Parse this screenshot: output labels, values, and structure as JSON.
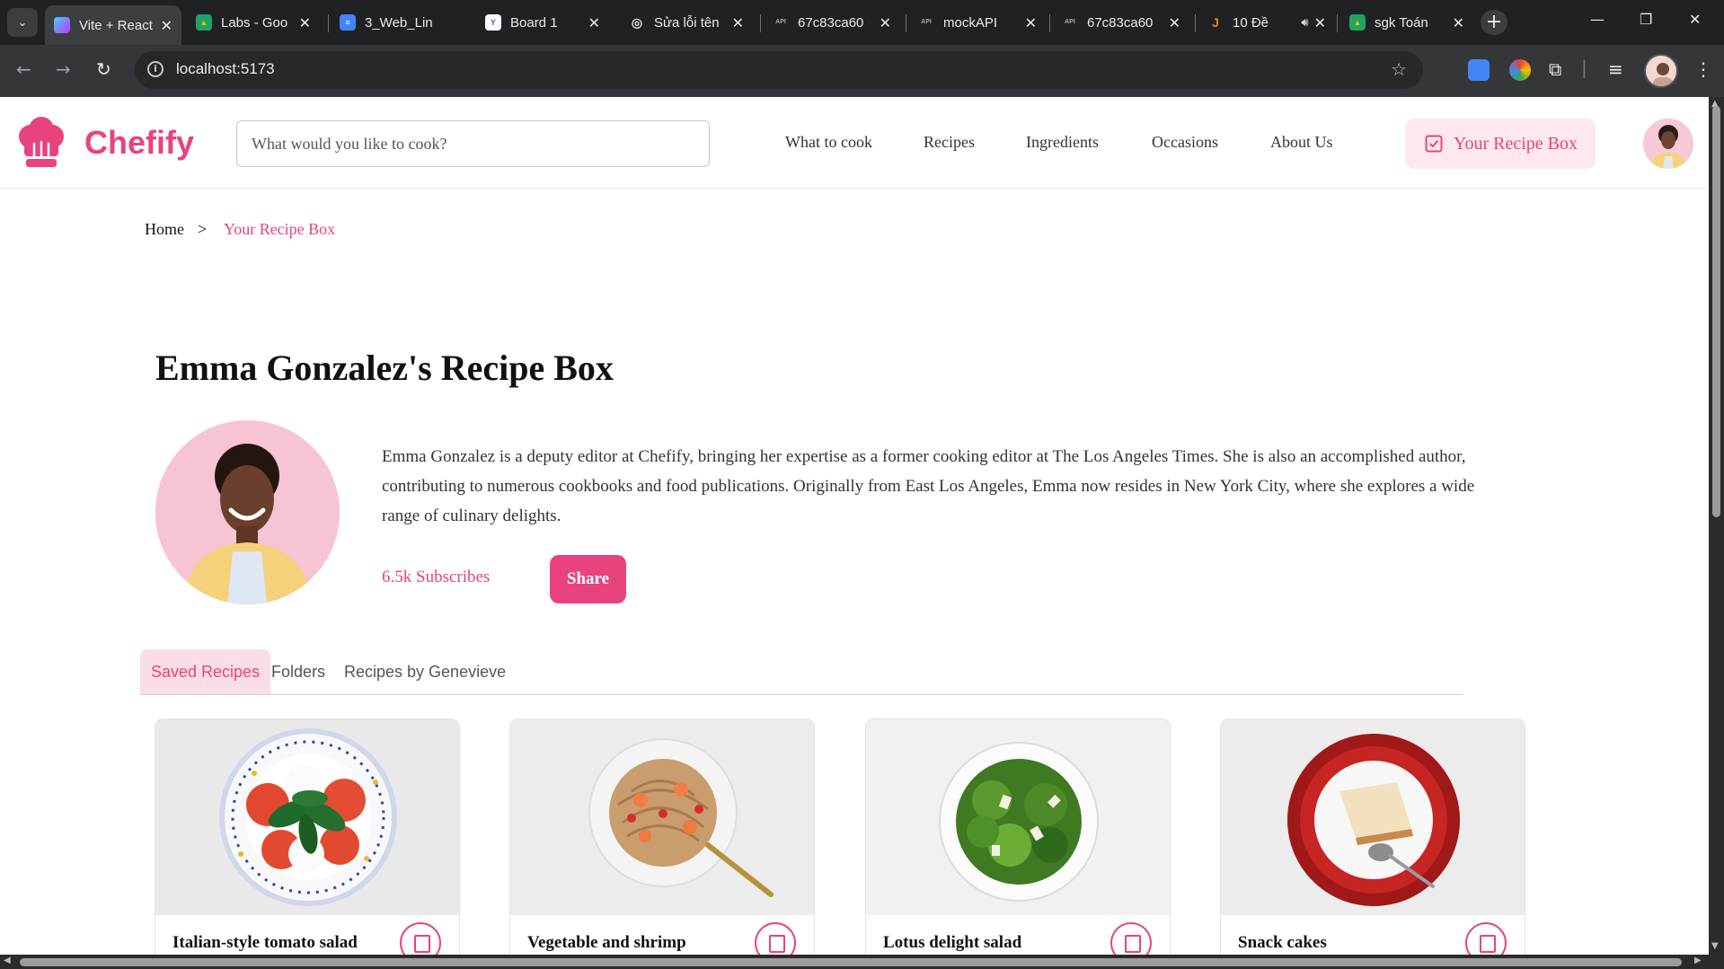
{
  "browser": {
    "tabs": [
      {
        "title": "Vite + React",
        "fav_color": "#8f6cf7",
        "fav_text": "V"
      },
      {
        "title": "Labs - Goo",
        "fav_color": "#1fa463",
        "fav_text": "▲"
      },
      {
        "title": "3_Web_Lin",
        "fav_color": "#4285f4",
        "fav_text": "≡"
      },
      {
        "title": "Board 1",
        "fav_color": "#3d5afe",
        "fav_text": "Y"
      },
      {
        "title": "Sửa lỗi tên",
        "fav_color": "#cccccc",
        "fav_text": "◎"
      },
      {
        "title": "67c83ca60",
        "fav_color": "#444444",
        "fav_text": "API"
      },
      {
        "title": "mockAPI",
        "fav_color": "#444444",
        "fav_text": "API"
      },
      {
        "title": "67c83ca60",
        "fav_color": "#444444",
        "fav_text": "API"
      },
      {
        "title": "10 Đề",
        "fav_color": "#f57c00",
        "fav_text": "J"
      },
      {
        "title": "sgk Toán",
        "fav_color": "#1fa463",
        "fav_text": "▲"
      }
    ],
    "url": "localhost:5173"
  },
  "site": {
    "brand": "Chefify",
    "brand_color": "#e8437f",
    "search_placeholder": "What would you like to cook?",
    "nav": [
      "What to cook",
      "Recipes",
      "Ingredients",
      "Occasions",
      "About Us"
    ],
    "recipe_box_label": "Your Recipe Box"
  },
  "breadcrumb": {
    "home": "Home",
    "separator": ">",
    "current": "Your Recipe Box"
  },
  "profile": {
    "title": "Emma Gonzalez's Recipe Box",
    "bio": "Emma Gonzalez is a deputy editor at Chefify, bringing her expertise as a former cooking editor at The Los Angeles Times. She is also an accomplished author, contributing to numerous cookbooks and food publications. Originally from East Los Angeles, Emma now resides in New York City, where she explores a wide range of culinary delights.",
    "subscribers": "6.5k Subscribes",
    "share_label": "Share"
  },
  "tabs": {
    "saved": "Saved Recipes",
    "folders": "Folders",
    "by_author": "Recipes by Genevieve"
  },
  "cards": [
    {
      "title": "Italian-style tomato salad"
    },
    {
      "title": "Vegetable and shrimp"
    },
    {
      "title": "Lotus delight salad"
    },
    {
      "title": "Snack cakes"
    }
  ]
}
